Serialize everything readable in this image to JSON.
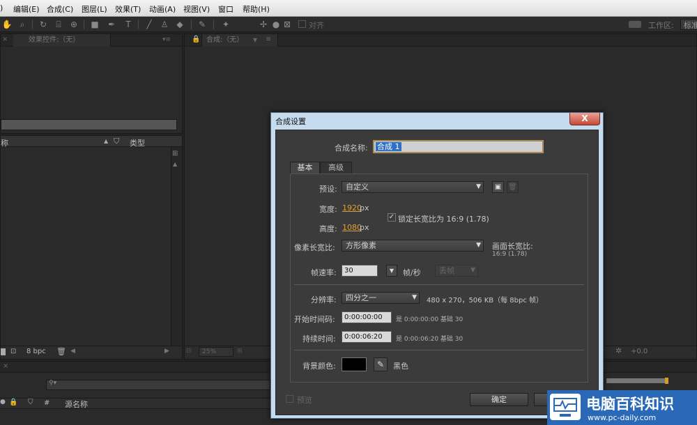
{
  "menubar": {
    "items": [
      "编辑(E)",
      "合成(C)",
      "图层(L)",
      "效果(T)",
      "动画(A)",
      "视图(V)",
      "窗口",
      "帮助(H)"
    ]
  },
  "toolbar": {
    "snap_label": "对齐",
    "workspace_label": "工作区:",
    "workspace_value": "标准"
  },
  "left_panel": {
    "effects_tab": "效果控件:（无）",
    "col_name": "称",
    "col_type": "类型",
    "bpc": "8 bpc"
  },
  "comp_panel": {
    "tab": "合成:（无）",
    "zoom": "25%",
    "exposure": "+0.0"
  },
  "timeline": {
    "source_name": "源名称",
    "hash": "#"
  },
  "dialog": {
    "title": "合成设置",
    "close": "X",
    "comp_name_label": "合成名称:",
    "comp_name_value": "合成 1",
    "tabs": [
      "基本",
      "高级"
    ],
    "preset_label": "预设:",
    "preset_value": "自定义",
    "width_label": "宽度:",
    "width_value": "1920",
    "height_label": "高度:",
    "height_value": "1080",
    "px": "px",
    "lock_label": "锁定长宽比为 16:9 (1.78)",
    "pixel_aspect_label": "像素长宽比:",
    "pixel_aspect_value": "方形像素",
    "frame_aspect_label": "画面长宽比:",
    "frame_aspect_value": "16:9 (1.78)",
    "framerate_label": "帧速率:",
    "framerate_value": "30",
    "fps_unit": "帧/秒",
    "drop_frame": "丢帧",
    "resolution_label": "分辨率:",
    "resolution_value": "四分之一",
    "resolution_info": "480 x 270，506 KB（每 8bpc 帧）",
    "start_tc_label": "开始时间码:",
    "start_tc_value": "0:00:00:00",
    "start_tc_info": "是 0:00:00:00  基础 30",
    "duration_label": "持续时间:",
    "duration_value": "0:00:06:20",
    "duration_info": "是 0:00:06:20  基础 30",
    "bg_label": "背景颜色:",
    "bg_color_name": "黑色",
    "bg_color": "#000000",
    "preview_label": "预览",
    "ok_label": "确定",
    "cancel_label": ""
  },
  "watermark": {
    "title": "电脑百科知识",
    "url": "www.pc-daily.com"
  }
}
